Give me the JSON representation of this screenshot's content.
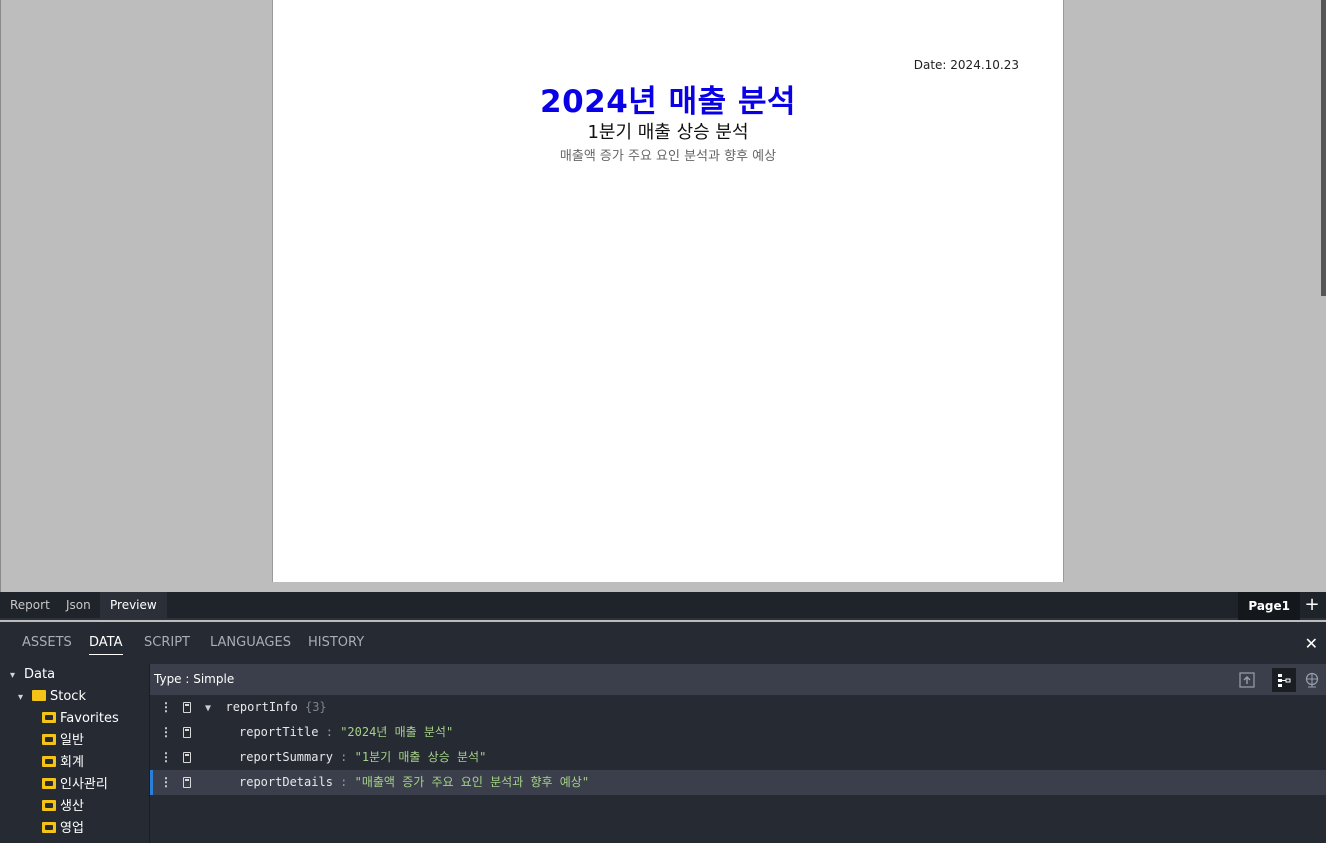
{
  "preview": {
    "date": "Date: 2024.10.23",
    "title": "2024년 매출 분석",
    "subtitle": "1분기 매출 상승 분석",
    "details": "매출액 증가 주요 요인 분석과 향후 예상"
  },
  "view_tabs": [
    "Report",
    "Json",
    "Preview"
  ],
  "active_view_tab": "Preview",
  "page_tab": "Page1",
  "add_page_icon": "+",
  "panel": {
    "tabs": [
      "ASSETS",
      "DATA",
      "SCRIPT",
      "LANGUAGES",
      "HISTORY"
    ],
    "active_tab": "DATA",
    "close_icon": "✕"
  },
  "tree": {
    "root": "Data",
    "stock": "Stock",
    "children": [
      "Favorites",
      "일반",
      "회계",
      "인사관리",
      "생산",
      "영업"
    ]
  },
  "editor": {
    "type_label": "Type : Simple",
    "root_key": "reportInfo",
    "root_count": "{3}",
    "rows": [
      {
        "key": "reportTitle",
        "value": "\"2024년 매출 분석\""
      },
      {
        "key": "reportSummary",
        "value": "\"1분기 매출 상승 분석\""
      },
      {
        "key": "reportDetails",
        "value": "\"매출액 증가 주요 요인 분석과 향후 예상\""
      }
    ],
    "selected_row_index": 2
  },
  "colors": {
    "title_blue": "#0a00e6",
    "panel_bg": "#262a33",
    "string_green": "#a6d189",
    "selection_accent": "#2b7fd7",
    "folder_yellow": "#f3c318"
  }
}
